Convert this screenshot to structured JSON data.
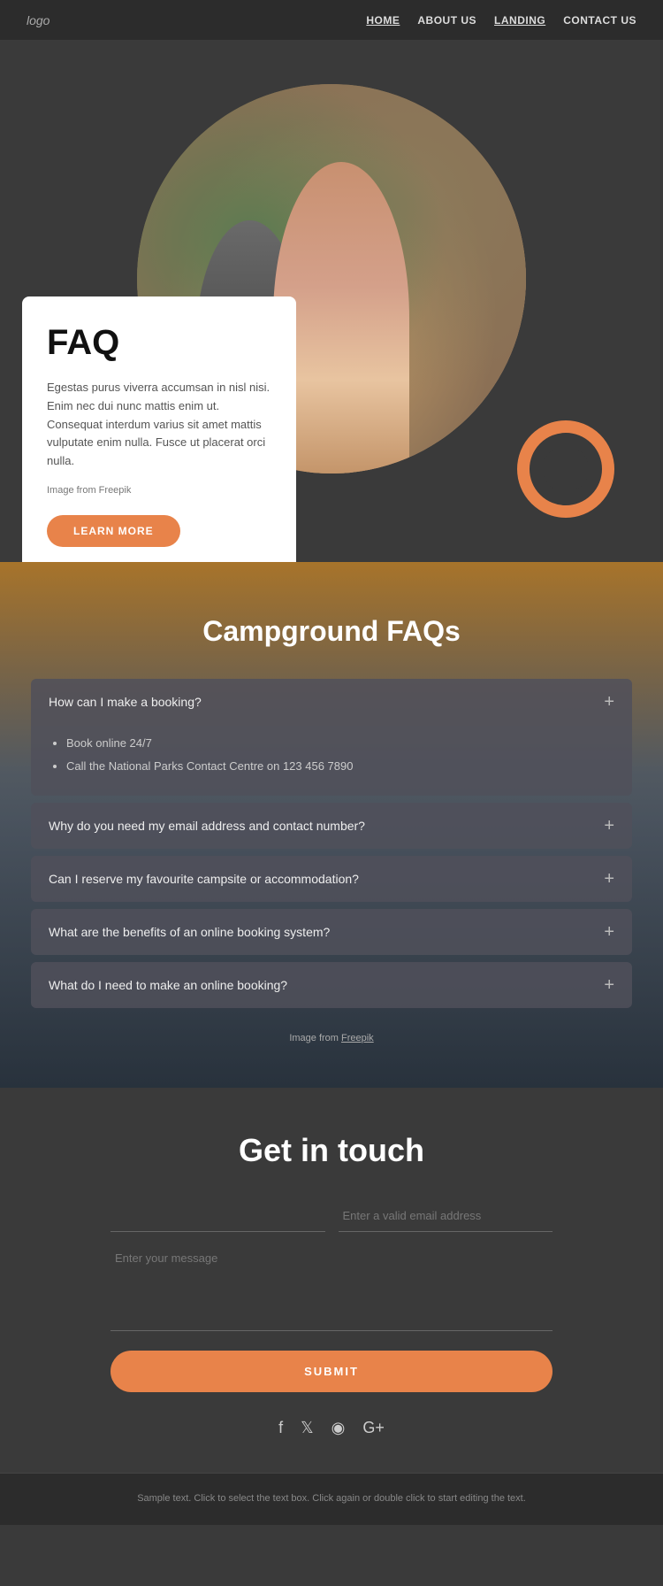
{
  "navbar": {
    "logo": "logo",
    "links": [
      {
        "label": "HOME",
        "active": true
      },
      {
        "label": "ABOUT US",
        "active": false
      },
      {
        "label": "LANDING",
        "active": false
      },
      {
        "label": "CONTACT US",
        "active": false
      }
    ]
  },
  "hero": {
    "faq_title": "FAQ",
    "faq_description": "Egestas purus viverra accumsan in nisl nisi. Enim nec dui nunc mattis enim ut. Consequat interdum varius sit amet mattis vulputate enim nulla. Fusce ut placerat orci nulla.",
    "image_credit": "Image from Freepik",
    "learn_more_label": "LEARN MORE"
  },
  "campground": {
    "title": "Campground FAQs",
    "faqs": [
      {
        "question": "How can I make a booking?",
        "open": true,
        "answer_items": [
          "Book online 24/7",
          "Call the National Parks Contact Centre on 123 456 7890"
        ]
      },
      {
        "question": "Why do you need my email address and contact number?",
        "open": false,
        "answer_items": []
      },
      {
        "question": "Can I reserve my favourite campsite or accommodation?",
        "open": false,
        "answer_items": []
      },
      {
        "question": "What are the benefits of an online booking system?",
        "open": false,
        "answer_items": []
      },
      {
        "question": "What do I need to make an online booking?",
        "open": false,
        "answer_items": []
      }
    ],
    "image_credit": "Image from ",
    "image_credit_link": "Freepik"
  },
  "contact": {
    "title": "Get in touch",
    "name_placeholder": "",
    "email_placeholder": "Enter a valid email address",
    "message_placeholder": "Enter your message",
    "submit_label": "SUBMIT"
  },
  "social": {
    "icons": [
      "f",
      "🐦",
      "⬤",
      "G+"
    ]
  },
  "footer": {
    "text": "Sample text. Click to select the text box. Click again or double\nclick to start editing the text."
  }
}
